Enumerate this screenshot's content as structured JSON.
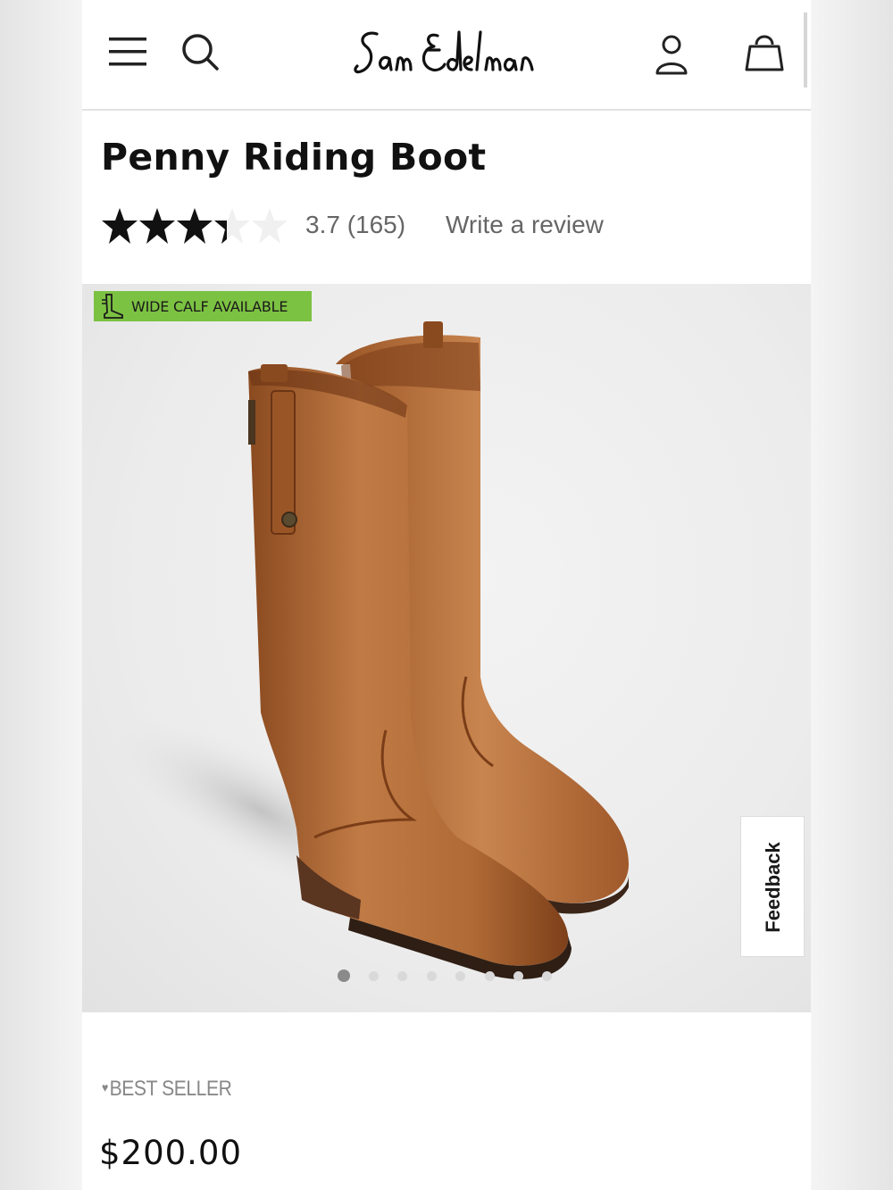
{
  "header": {
    "brand": "Sam Edelman",
    "icons": [
      "menu-icon",
      "search-icon",
      "account-icon",
      "bag-icon"
    ]
  },
  "product": {
    "title": "Penny Riding Boot",
    "rating_stars": 3.7,
    "rating_text": "3.7 (165)",
    "write_review": "Write a review",
    "badge": "WIDE CALF AVAILABLE",
    "badge_color": "#7cc242",
    "image": "cognac leather riding boots",
    "gallery_count": 8,
    "gallery_active": 1,
    "best_seller": "BEST SELLER",
    "price": "$200.00"
  },
  "feedback": {
    "label": "Feedback"
  }
}
